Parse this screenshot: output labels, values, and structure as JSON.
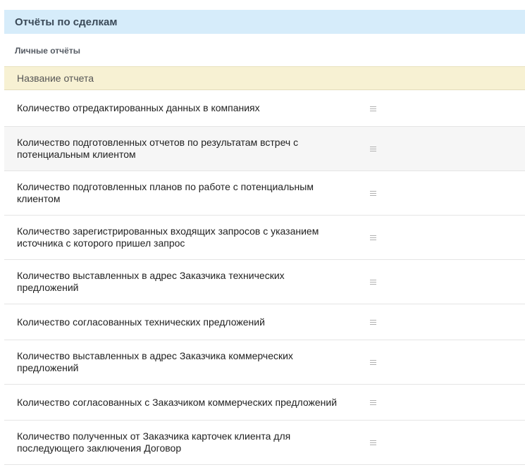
{
  "header": {
    "title": "Отчёты по сделкам"
  },
  "section": {
    "label": "Личные отчёты"
  },
  "table": {
    "column_header": "Название отчета",
    "row_icon": "list-icon",
    "rows": [
      "Количество отредактированных данных в компаниях",
      "Количество подготовленных отчетов по результатам встреч с потенциальным клиентом",
      "Количество подготовленных планов по работе с потенциальным клиентом",
      "Количество зарегистрированных входящих запросов с указанием источника с которого пришел запрос",
      "Количество выставленных в адрес Заказчика технических предложений",
      "Количество согласованных технических предложений",
      "Количество выставленных в адрес Заказчика коммерческих предложений",
      "Количество согласованных с Заказчиком коммерческих предложений",
      "Количество полученных от Заказчика карточек клиента для последующего заключения Договор"
    ]
  },
  "colors": {
    "header_bg": "#d6ecfa",
    "column_header_bg": "#f7f1d3",
    "alt_row_bg": "#f6f6f6"
  }
}
